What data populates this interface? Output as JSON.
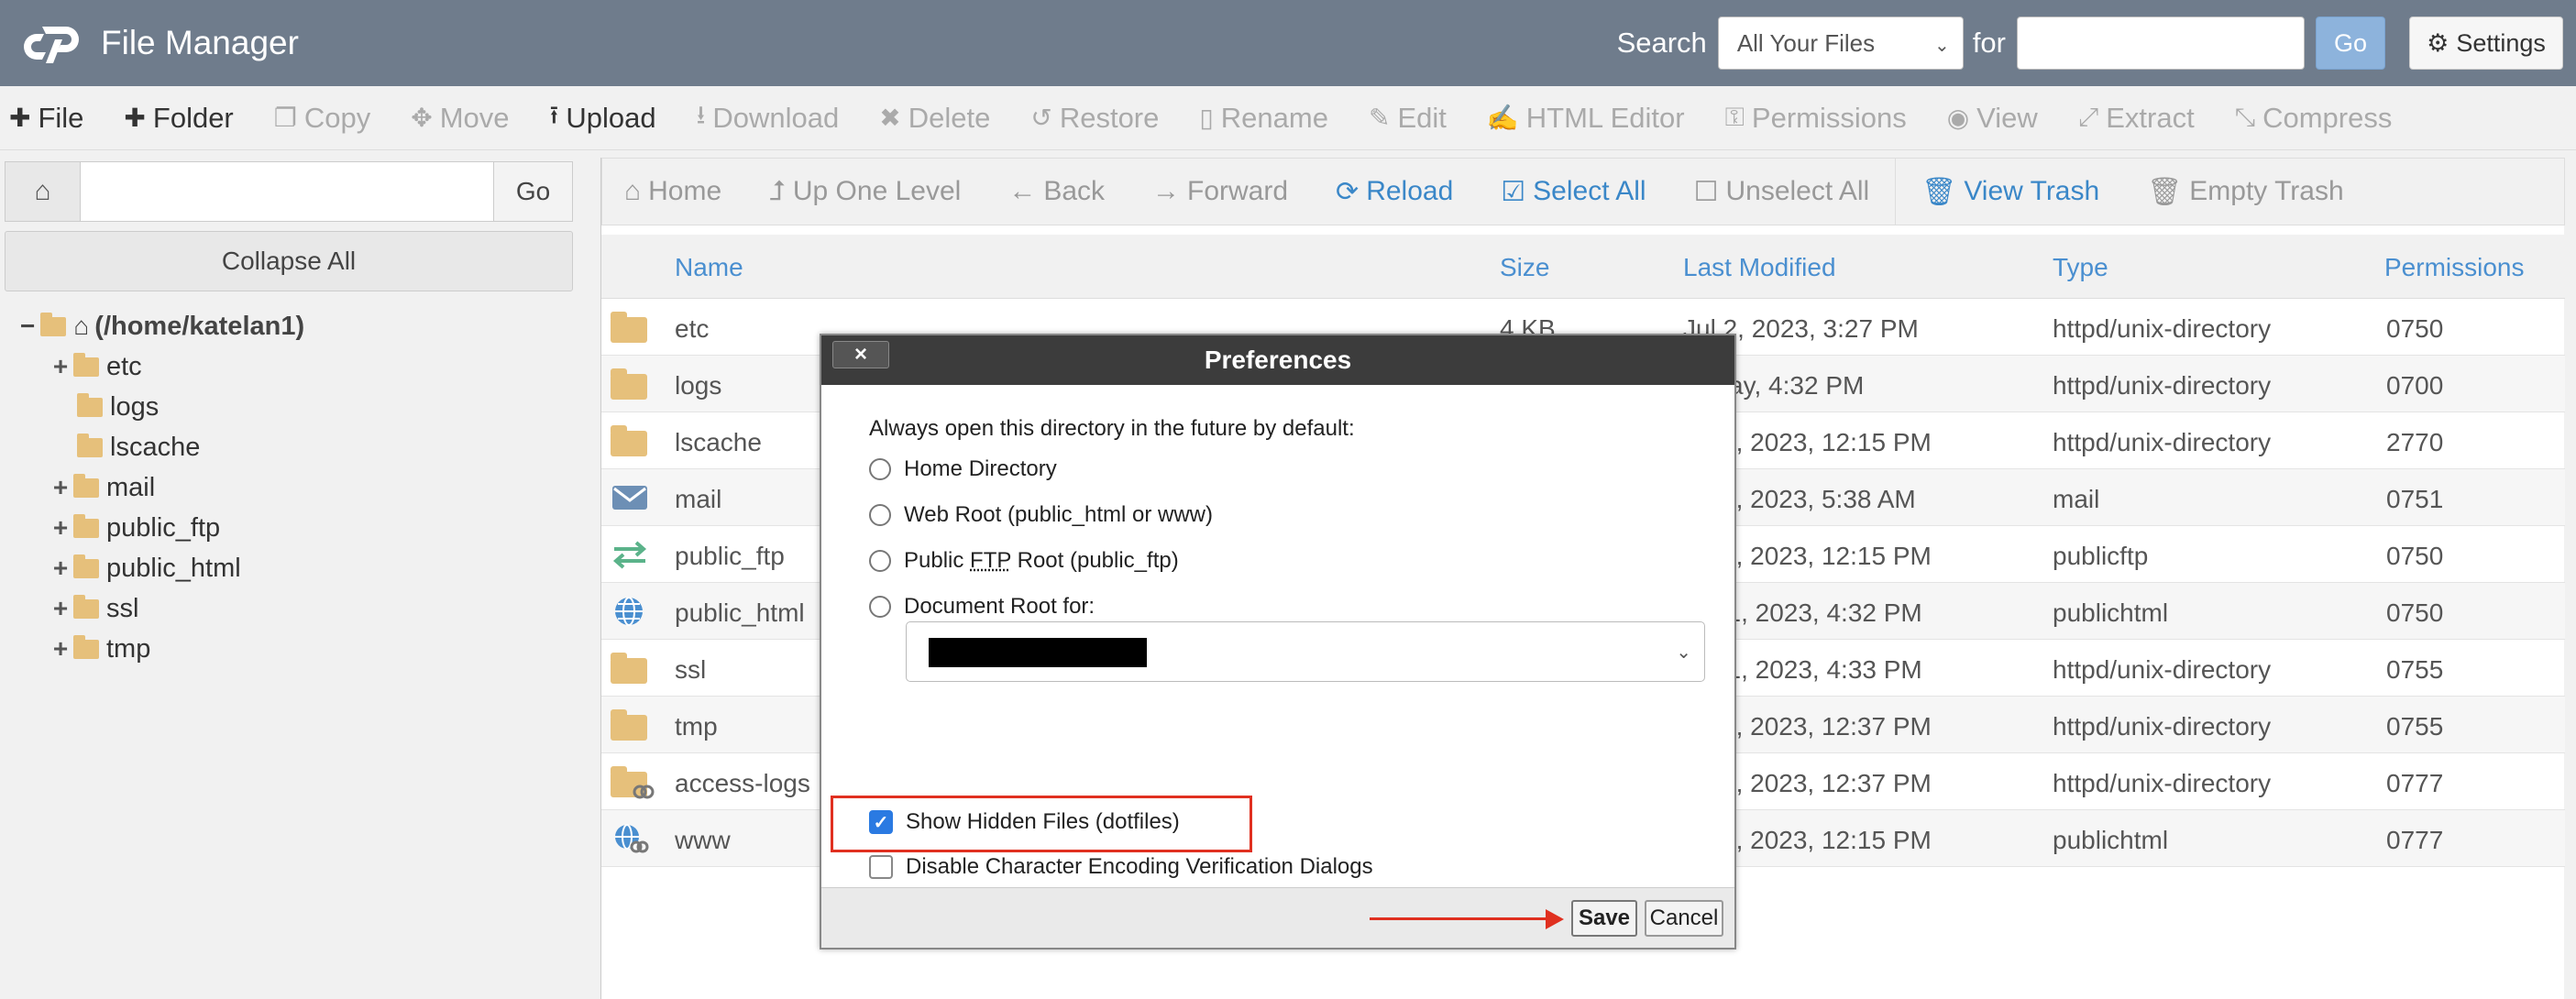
{
  "header": {
    "title": "File Manager",
    "search_label": "Search",
    "search_scope": "All Your Files",
    "for_label": "for",
    "search_value": "",
    "go_label": "Go",
    "settings_label": "Settings"
  },
  "toolbar": {
    "items": [
      {
        "label": "File",
        "icon": "plus-icon",
        "enabled": true
      },
      {
        "label": "Folder",
        "icon": "plus-icon",
        "enabled": true
      },
      {
        "label": "Copy",
        "icon": "copy-icon",
        "enabled": false
      },
      {
        "label": "Move",
        "icon": "move-icon",
        "enabled": false
      },
      {
        "label": "Upload",
        "icon": "upload-icon",
        "enabled": true
      },
      {
        "label": "Download",
        "icon": "download-icon",
        "enabled": false
      },
      {
        "label": "Delete",
        "icon": "delete-icon",
        "enabled": false
      },
      {
        "label": "Restore",
        "icon": "restore-icon",
        "enabled": false
      },
      {
        "label": "Rename",
        "icon": "rename-icon",
        "enabled": false
      },
      {
        "label": "Edit",
        "icon": "edit-icon",
        "enabled": false
      },
      {
        "label": "HTML Editor",
        "icon": "html-editor-icon",
        "enabled": false
      },
      {
        "label": "Permissions",
        "icon": "key-icon",
        "enabled": false
      },
      {
        "label": "View",
        "icon": "eye-icon",
        "enabled": false
      },
      {
        "label": "Extract",
        "icon": "extract-icon",
        "enabled": false
      },
      {
        "label": "Compress",
        "icon": "compress-icon",
        "enabled": false
      }
    ]
  },
  "sidebar": {
    "path_go": "Go",
    "collapse_label": "Collapse All",
    "root_label": "(/home/katelan1)",
    "tree": [
      {
        "label": "etc",
        "expandable": true
      },
      {
        "label": "logs",
        "expandable": false
      },
      {
        "label": "lscache",
        "expandable": false
      },
      {
        "label": "mail",
        "expandable": true
      },
      {
        "label": "public_ftp",
        "expandable": true
      },
      {
        "label": "public_html",
        "expandable": true
      },
      {
        "label": "ssl",
        "expandable": true
      },
      {
        "label": "tmp",
        "expandable": true
      }
    ]
  },
  "nav": {
    "home": "Home",
    "up": "Up One Level",
    "back": "Back",
    "forward": "Forward",
    "reload": "Reload",
    "select_all": "Select All",
    "unselect_all": "Unselect All",
    "view_trash": "View Trash",
    "empty_trash": "Empty Trash"
  },
  "table": {
    "columns": [
      "Name",
      "Size",
      "Last Modified",
      "Type",
      "Permissions"
    ],
    "rows": [
      {
        "icon": "folder-icon",
        "name": "etc",
        "size": "4 KB",
        "modified": "Jul 2, 2023, 3:27 PM",
        "type": "httpd/unix-directory",
        "perms": "0750"
      },
      {
        "icon": "folder-icon",
        "name": "logs",
        "size": "",
        "modified": "ay, 4:32 PM",
        "type": "httpd/unix-directory",
        "perms": "0700"
      },
      {
        "icon": "folder-icon",
        "name": "lscache",
        "size": "",
        "modified": "3, 2023, 12:15 PM",
        "type": "httpd/unix-directory",
        "perms": "2770"
      },
      {
        "icon": "mail-icon",
        "name": "mail",
        "size": "",
        "modified": "4, 2023, 5:38 AM",
        "type": "mail",
        "perms": "0751"
      },
      {
        "icon": "transfer-icon",
        "name": "public_ftp",
        "size": "",
        "modified": "3, 2023, 12:15 PM",
        "type": "publicftp",
        "perms": "0750"
      },
      {
        "icon": "globe-icon",
        "name": "public_html",
        "size": "",
        "modified": "11, 2023, 4:32 PM",
        "type": "publichtml",
        "perms": "0750"
      },
      {
        "icon": "folder-icon",
        "name": "ssl",
        "size": "",
        "modified": "11, 2023, 4:33 PM",
        "type": "httpd/unix-directory",
        "perms": "0755"
      },
      {
        "icon": "folder-icon",
        "name": "tmp",
        "size": "",
        "modified": "3, 2023, 12:37 PM",
        "type": "httpd/unix-directory",
        "perms": "0755"
      },
      {
        "icon": "folder-link-icon",
        "name": "access-logs",
        "size": "",
        "modified": "3, 2023, 12:37 PM",
        "type": "httpd/unix-directory",
        "perms": "0777"
      },
      {
        "icon": "globe-link-icon",
        "name": "www",
        "size": "",
        "modified": "3, 2023, 12:15 PM",
        "type": "publichtml",
        "perms": "0777"
      }
    ]
  },
  "dialog": {
    "title": "Preferences",
    "close": "×",
    "intro": "Always open this directory in the future by default:",
    "options": [
      {
        "label": "Home Directory"
      },
      {
        "label": "Web Root (public_html or www)"
      },
      {
        "label_pre": "Public ",
        "label_abbr": "FTP",
        "label_post": " Root (public_ftp)"
      },
      {
        "label": "Document Root for:"
      }
    ],
    "show_hidden": {
      "label": "Show Hidden Files (dotfiles)",
      "checked": true
    },
    "disable_encoding": {
      "label": "Disable Character Encoding Verification Dialogs",
      "checked": false
    },
    "save": "Save",
    "cancel": "Cancel"
  },
  "colors": {
    "topbar": "#6f7c8c",
    "link_blue": "#3a87c8",
    "highlight_red": "#e03020",
    "folder": "#e6c07b"
  }
}
